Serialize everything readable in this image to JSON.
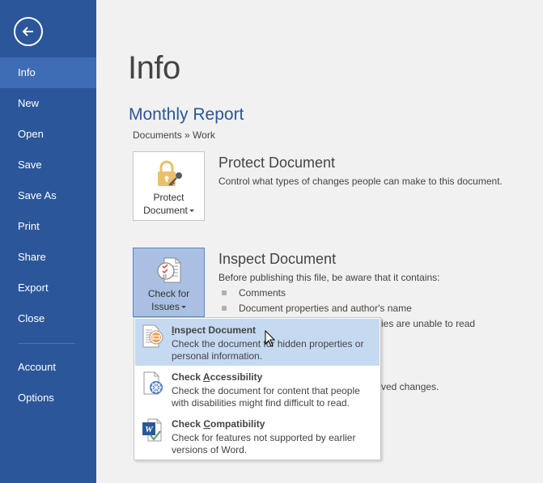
{
  "sidebar": {
    "back_label": "Back",
    "items": [
      {
        "label": "Info",
        "active": true
      },
      {
        "label": "New"
      },
      {
        "label": "Open"
      },
      {
        "label": "Save"
      },
      {
        "label": "Save As"
      },
      {
        "label": "Print"
      },
      {
        "label": "Share"
      },
      {
        "label": "Export"
      },
      {
        "label": "Close"
      },
      {
        "label": "Account"
      },
      {
        "label": "Options"
      }
    ]
  },
  "main": {
    "page_title": "Info",
    "document_title": "Monthly Report",
    "breadcrumb": "Documents » Work",
    "protect": {
      "button_line1": "Protect",
      "button_line2": "Document",
      "title": "Protect Document",
      "description": "Control what types of changes people can make to this document."
    },
    "inspect": {
      "button_line1": "Check for",
      "button_line2": "Issues",
      "title": "Inspect Document",
      "description": "Before publishing this file, be aware that it contains:",
      "bullets": [
        "Comments",
        "Document properties and author's name",
        "ies are unable to read"
      ],
      "partial_text": "ved changes."
    }
  },
  "menu": {
    "items": [
      {
        "title_u": "I",
        "title_rest": "nspect Document",
        "description": "Check the document for hidden properties or personal information.",
        "icon": "inspect-document-icon"
      },
      {
        "title_pre": "Check ",
        "title_u": "A",
        "title_rest": "ccessibility",
        "description": "Check the document for content that people with disabilities might find difficult to read.",
        "icon": "check-accessibility-icon"
      },
      {
        "title_pre": "Check ",
        "title_u": "C",
        "title_rest": "ompatibility",
        "description": "Check for features not supported by earlier versions of Word.",
        "icon": "check-compatibility-icon"
      }
    ]
  },
  "colors": {
    "sidebar_bg": "#2b579a",
    "sidebar_active": "#3e6db5",
    "accent_text": "#2b579a",
    "menu_hover": "#c5d9f1",
    "pressed_button": "#a9c0e3"
  }
}
